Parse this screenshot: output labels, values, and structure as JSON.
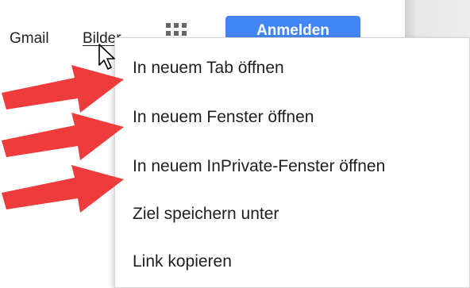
{
  "header": {
    "links": {
      "gmail": "Gmail",
      "images": "Bilder"
    },
    "signin_button": "Anmelden",
    "apps_icon": "apps-grid-icon"
  },
  "context_menu": {
    "items": [
      "In neuem Tab öffnen",
      "In neuem Fenster öffnen",
      "In neuem InPrivate-Fenster öffnen",
      "Ziel speichern unter",
      "Link kopieren"
    ]
  },
  "annotations": {
    "arrow_color": "#ee3b3b",
    "arrow_icon": "red-arrow-icon"
  },
  "colors": {
    "signin_button": "#4285f4",
    "menu_text": "#1f1f1f"
  }
}
